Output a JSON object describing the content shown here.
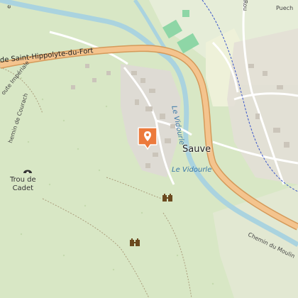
{
  "map": {
    "town": "Sauve",
    "main_road": "de Saint-Hippolyte-du-Fort",
    "poi": {
      "line1": "Trou de",
      "line2": "Cadet"
    },
    "river_1": "Le Vidourle",
    "river_2": "Le Vidourle",
    "road_imperiale": "oute Impériale",
    "road_courach": "hemin de Courach",
    "road_moulin": "Chemin du Moulin",
    "place_puech": "Puech",
    "road_rou": "Rou",
    "road_topleft": "e"
  },
  "colors": {
    "background": "#d8e7c5",
    "forest": "#c6dcb0",
    "main_road_fill": "#f4c48e",
    "main_road_casing": "#d59a5a",
    "river": "#aad3df",
    "urban": "#dedbd4",
    "building": "#cbc5ba",
    "marker": "#ec7a3c",
    "railway_dash": "#3a56c9",
    "sports": "#8ed6a6"
  },
  "icons": {
    "marker": "map-pin-icon",
    "ruins": "castle-ruin-icon",
    "cave": "cave-icon"
  }
}
